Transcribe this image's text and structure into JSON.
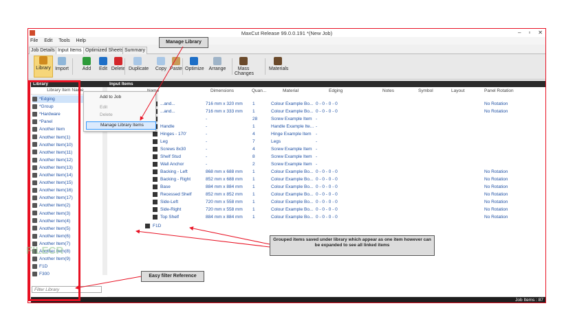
{
  "window": {
    "title": "MaxCut Release 99.0.0.191 *(New Job)",
    "controls": [
      "–",
      "▫",
      "✕"
    ]
  },
  "menu": [
    "File",
    "Edit",
    "Tools",
    "Help"
  ],
  "tabs": [
    "Job Details",
    "Input Items",
    "Optimized Sheets",
    "Summary"
  ],
  "toolbar": [
    {
      "label": "Library",
      "icon": "library-icon",
      "color": "#d08a1e"
    },
    {
      "label": "Import",
      "icon": "import-icon",
      "color": "#8fb6d9"
    },
    {
      "label": "Add",
      "icon": "add-icon",
      "color": "#2e9b3a"
    },
    {
      "label": "Edit",
      "icon": "edit-icon",
      "color": "#1e6fc7"
    },
    {
      "label": "Delete",
      "icon": "delete-icon",
      "color": "#d3262a"
    },
    {
      "label": "Duplicate",
      "icon": "duplicate-icon",
      "color": "#a9c7e6"
    },
    {
      "label": "Copy",
      "icon": "copy-icon",
      "color": "#a9c7e6"
    },
    {
      "label": "Paste",
      "icon": "paste-icon",
      "color": "#c89a58"
    },
    {
      "label": "Optimize",
      "icon": "optimize-icon",
      "color": "#1e6fc7"
    },
    {
      "label": "Arrange",
      "icon": "arrange-icon",
      "color": "#9fb4c8"
    },
    {
      "label": "Mass Changes",
      "icon": "mass-changes-icon",
      "color": "#6b4a2b"
    },
    {
      "label": "Materials",
      "icon": "materials-icon",
      "color": "#6b4a2b"
    }
  ],
  "library": {
    "header": "Library",
    "column": "Library Item Name",
    "items": [
      "*Edging",
      "*Group",
      "*Hardware",
      "*Panel",
      "Another Item",
      "Another Item(1)",
      "Another Item(10)",
      "Another Item(11)",
      "Another Item(12)",
      "Another Item(13)",
      "Another Item(14)",
      "Another Item(15)",
      "Another Item(16)",
      "Another Item(17)",
      "Another Item(2)",
      "Another Item(3)",
      "Another Item(4)",
      "Another Item(5)",
      "Another Item(6)",
      "Another Item(7)",
      "Another Item(8)",
      "Another Item(9)",
      "F1D",
      "F300"
    ],
    "filter_placeholder": "Filter Library"
  },
  "input_items": {
    "header": "Input Items",
    "columns": [
      "Name",
      "Dimensions",
      "Quan...",
      "Material",
      "Edging",
      "Notes",
      "Symbol",
      "Layout",
      "Panel Rotation"
    ],
    "rows": [
      {
        "name": "...and...",
        "dims": "716 mm x 320 mm",
        "qty": "1",
        "material": "Colour Example Bo...",
        "edging": "0 - 0 - 0 - 0",
        "rotation": "No Rotation"
      },
      {
        "name": "...and...",
        "dims": "716 mm x 333 mm",
        "qty": "1",
        "material": "Colour Example Bo...",
        "edging": "0 - 0 - 0 - 0",
        "rotation": "No Rotation"
      },
      {
        "name": "",
        "dims": "-",
        "qty": "28",
        "material": "Screw Example Item",
        "edging": "-",
        "rotation": ""
      },
      {
        "name": "Handle",
        "dims": "-",
        "qty": "1",
        "material": "Handle Example Ite...",
        "edging": "-",
        "rotation": ""
      },
      {
        "name": "Hinges - 170'",
        "dims": "-",
        "qty": "4",
        "material": "Hinge Example Item",
        "edging": "-",
        "rotation": ""
      },
      {
        "name": "Leg",
        "dims": "-",
        "qty": "7",
        "material": "Legs",
        "edging": "-",
        "rotation": ""
      },
      {
        "name": "Screws 8x30",
        "dims": "-",
        "qty": "4",
        "material": "Screw Example Item",
        "edging": "-",
        "rotation": ""
      },
      {
        "name": "Shelf Stud",
        "dims": "-",
        "qty": "8",
        "material": "Screw Example Item",
        "edging": "-",
        "rotation": ""
      },
      {
        "name": "Wall Anchor",
        "dims": "-",
        "qty": "2",
        "material": "Screw Example Item",
        "edging": "-",
        "rotation": ""
      },
      {
        "name": "Backing - Left",
        "dims": "868 mm x 688 mm",
        "qty": "1",
        "material": "Colour Example Bo...",
        "edging": "0 - 0 - 0 - 0",
        "rotation": "No Rotation"
      },
      {
        "name": "Backing - Right",
        "dims": "852 mm x 688 mm",
        "qty": "1",
        "material": "Colour Example Bo...",
        "edging": "0 - 0 - 0 - 0",
        "rotation": "No Rotation"
      },
      {
        "name": "Base",
        "dims": "884 mm x 884 mm",
        "qty": "1",
        "material": "Colour Example Bo...",
        "edging": "0 - 0 - 0 - 0",
        "rotation": "No Rotation"
      },
      {
        "name": "Recessed Shelf",
        "dims": "852 mm x 852 mm",
        "qty": "1",
        "material": "Colour Example Bo...",
        "edging": "0 - 0 - 0 - 0",
        "rotation": "No Rotation"
      },
      {
        "name": "Side-Left",
        "dims": "720 mm x 558 mm",
        "qty": "1",
        "material": "Colour Example Bo...",
        "edging": "0 - 0 - 0 - 0",
        "rotation": "No Rotation"
      },
      {
        "name": "Side-Right",
        "dims": "720 mm x 558 mm",
        "qty": "1",
        "material": "Colour Example Bo...",
        "edging": "0 - 0 - 0 - 0",
        "rotation": "No Rotation"
      },
      {
        "name": "Top Shelf",
        "dims": "884 mm x 884 mm",
        "qty": "1",
        "material": "Colour Example Bo...",
        "edging": "0 - 0 - 0 - 0",
        "rotation": "No Rotation"
      }
    ],
    "group_row": "F1D"
  },
  "context_menu": {
    "items": [
      "Add to Job",
      "Edit",
      "Delete",
      "Manage Library Items"
    ]
  },
  "status": {
    "job_items": "Job Items : 87"
  },
  "callouts": {
    "manage": "Manage Library",
    "grouped": "Grouped items saved under library which appear as one item however can be expanded to see all linked items",
    "filter": "Easy filter Reference"
  },
  "watermark": "FILECR",
  "colors": {
    "accent": "#e81123",
    "link": "#1d4fa3",
    "header_dark": "#2b2b2b"
  }
}
